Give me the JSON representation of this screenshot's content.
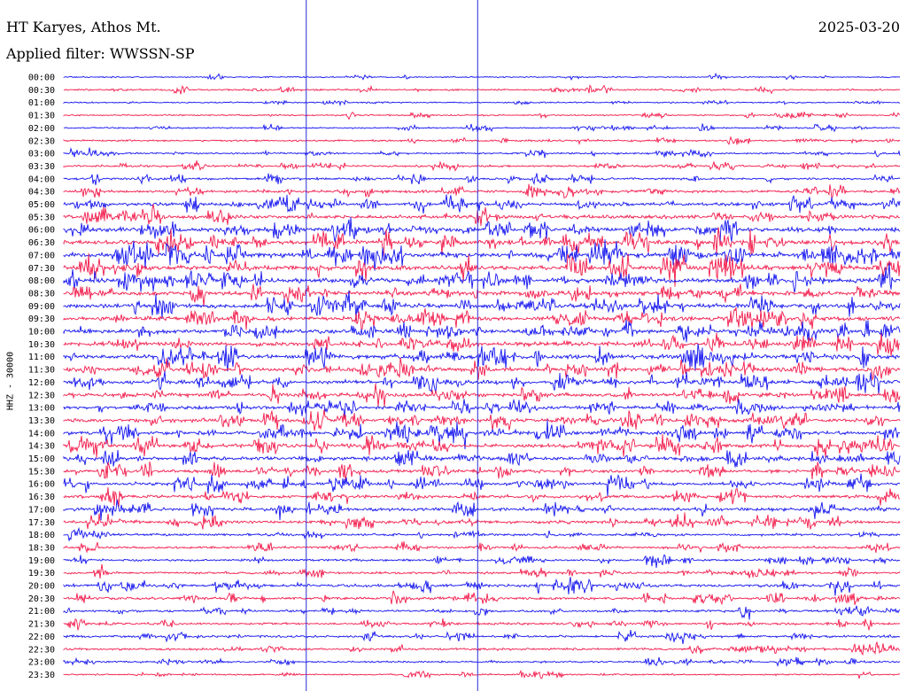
{
  "header": {
    "station": "HT Karyes, Athos Mt.",
    "date": "2025-03-20",
    "filter": "Applied filter: WWSSN-SP"
  },
  "axis": {
    "channel_label": "HHZ - 30000"
  },
  "colors": {
    "blue": "#1515f0",
    "red": "#f21c4c",
    "marker": "#2a2ad8"
  },
  "chart_data": {
    "type": "line",
    "time_labels": [
      "00:00",
      "00:30",
      "01:00",
      "01:30",
      "02:00",
      "02:30",
      "03:00",
      "03:30",
      "04:00",
      "04:30",
      "05:00",
      "05:30",
      "06:00",
      "06:30",
      "07:00",
      "07:30",
      "08:00",
      "08:30",
      "09:00",
      "09:30",
      "10:00",
      "10:30",
      "11:00",
      "11:30",
      "12:00",
      "12:30",
      "13:00",
      "13:30",
      "14:00",
      "14:30",
      "15:00",
      "15:30",
      "16:00",
      "16:30",
      "17:00",
      "17:30",
      "18:00",
      "18:30",
      "19:00",
      "19:30",
      "20:00",
      "20:30",
      "21:00",
      "21:30",
      "22:00",
      "22:30",
      "23:00",
      "23:30"
    ],
    "amplitude_levels": [
      0.08,
      0.18,
      0.07,
      0.1,
      0.12,
      0.16,
      0.2,
      0.22,
      0.28,
      0.38,
      0.5,
      0.62,
      0.72,
      0.8,
      0.85,
      0.85,
      0.8,
      0.75,
      0.7,
      0.7,
      0.68,
      0.7,
      0.75,
      0.72,
      0.66,
      0.58,
      0.52,
      0.58,
      0.62,
      0.64,
      0.6,
      0.55,
      0.5,
      0.5,
      0.55,
      0.48,
      0.3,
      0.3,
      0.28,
      0.3,
      0.42,
      0.4,
      0.28,
      0.3,
      0.28,
      0.3,
      0.2,
      0.12
    ],
    "marker_minutes": [
      17.4,
      29.7
    ]
  }
}
